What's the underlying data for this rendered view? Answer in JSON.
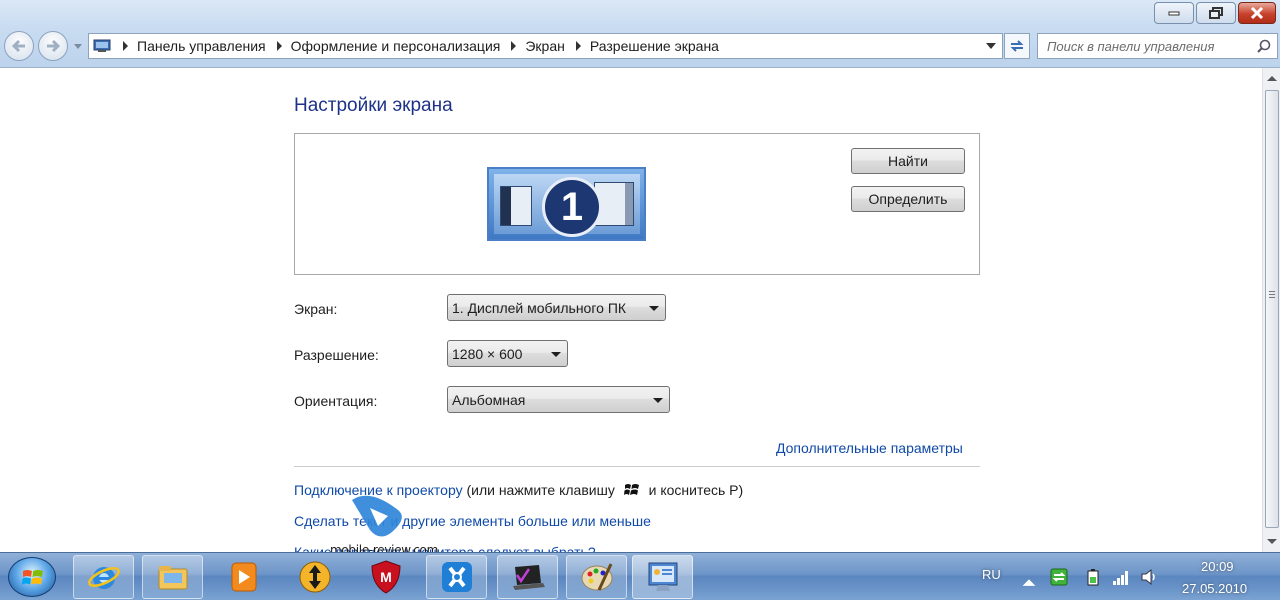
{
  "window": {
    "minimize_icon": "minimize-icon",
    "maximize_icon": "restore-icon",
    "close_icon": "close-icon"
  },
  "nav": {
    "back_icon": "back-arrow-icon",
    "forward_icon": "forward-arrow-icon"
  },
  "breadcrumb": {
    "items": [
      "Панель управления",
      "Оформление и персонализация",
      "Экран",
      "Разрешение экрана"
    ]
  },
  "search": {
    "placeholder": "Поиск в панели управления"
  },
  "main": {
    "title": "Настройки экрана",
    "monitor_number": "1",
    "detect_button": "Найти",
    "identify_button": "Определить",
    "display_label": "Экран:",
    "display_value": "1. Дисплей мобильного ПК",
    "resolution_label": "Разрешение:",
    "resolution_value": "1280 × 600",
    "orientation_label": "Ориентация:",
    "orientation_value": "Альбомная",
    "advanced_link": "Дополнительные параметры",
    "projector_link": "Подключение к проектору",
    "projector_hint_before": "(или нажмите клавишу",
    "projector_hint_after": "и коснитесь P)",
    "text_size_link": "Сделать текст и другие элементы больше или меньше",
    "cutoff_link": "Какие параметры монитора следует выбрать?"
  },
  "watermark": {
    "text": "mobile-review.com"
  },
  "taskbar": {
    "apps": [
      "internet-explorer",
      "windows-explorer",
      "media-player",
      "antivirus",
      "mcafee",
      "app-x",
      "vaio-notes",
      "paint",
      "display-settings"
    ],
    "language": "RU",
    "time": "20:09",
    "date": "27.05.2010"
  }
}
